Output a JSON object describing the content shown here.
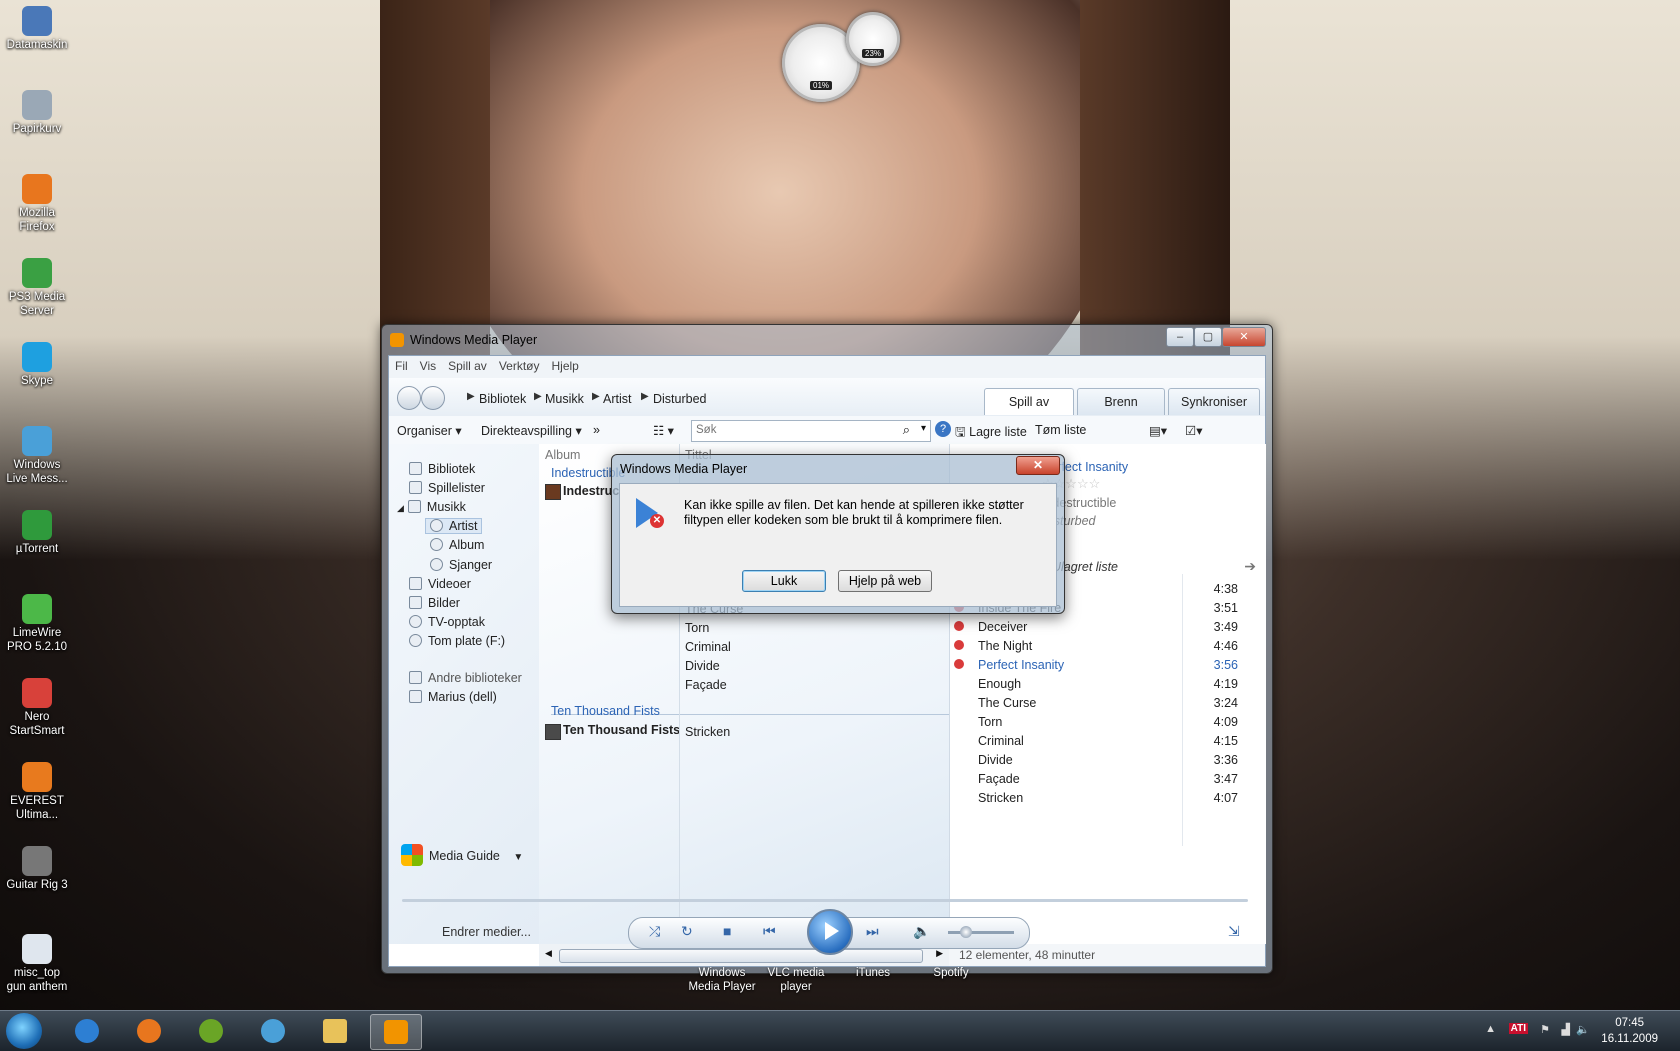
{
  "desktop_icons": [
    {
      "label": "Datamaskin",
      "icon": "computer-icon",
      "color": "#4a78b8"
    },
    {
      "label": "Papirkurv",
      "icon": "recycle-bin-icon",
      "color": "#9aa8b6"
    },
    {
      "label": "Mozilla Firefox",
      "icon": "firefox-icon",
      "color": "#e8761e"
    },
    {
      "label": "PS3 Media Server",
      "icon": "ps3-media-server-icon",
      "color": "#3aa043"
    },
    {
      "label": "Skype",
      "icon": "skype-icon",
      "color": "#1ea0e0"
    },
    {
      "label": "Windows Live Mess...",
      "icon": "messenger-icon",
      "color": "#4aa0d8"
    },
    {
      "label": "µTorrent",
      "icon": "utorrent-icon",
      "color": "#2f9a3c"
    },
    {
      "label": "LimeWire PRO 5.2.10",
      "icon": "limewire-icon",
      "color": "#4cb848"
    },
    {
      "label": "Nero StartSmart",
      "icon": "nero-icon",
      "color": "#d8413a"
    },
    {
      "label": "EVEREST Ultima...",
      "icon": "everest-icon",
      "color": "#e87a1e"
    },
    {
      "label": "Guitar Rig 3",
      "icon": "guitar-rig-icon",
      "color": "#777777"
    },
    {
      "label": "misc_top gun anthem",
      "icon": "mp3-file-icon",
      "color": "#dfe6ee"
    }
  ],
  "gadget": {
    "cpu_percent": "01%",
    "memory_percent": "23%"
  },
  "window": {
    "title": "Windows Media Player",
    "menu": [
      "Fil",
      "Vis",
      "Spill av",
      "Verktøy",
      "Hjelp"
    ],
    "breadcrumb": [
      "Bibliotek",
      "Musikk",
      "Artist",
      "Disturbed"
    ],
    "tabs": [
      "Spill av",
      "Brenn",
      "Synkroniser"
    ],
    "toolbar": {
      "organize": "Organiser",
      "stream": "Direkteavspilling",
      "more": "»",
      "search_placeholder": "Søk",
      "save_list": "Lagre liste",
      "clear_list": "Tøm liste"
    },
    "nav": {
      "library": "Bibliotek",
      "playlists": "Spillelister",
      "music": "Musikk",
      "artist": "Artist",
      "album": "Album",
      "genre": "Sjanger",
      "videos": "Videoer",
      "pictures": "Bilder",
      "tv": "TV-opptak",
      "blank_disc": "Tom plate (F:)",
      "other_libraries": "Andre biblioteker",
      "other_user": "Marius (dell)",
      "media_guide": "Media Guide"
    },
    "content": {
      "col_album": "Album",
      "col_title": "Tittel",
      "group1_link": "Indestructible",
      "group1_album": "Indestructible",
      "group1_tracks": [
        "The Curse",
        "Torn",
        "Criminal",
        "Divide",
        "Façade"
      ],
      "group2_link": "Ten Thousand Fists",
      "group2_album": "Ten Thousand Fists",
      "group2_tracks": [
        "Stricken"
      ]
    },
    "now_playing": {
      "title": "Perfect Insanity",
      "album": "Indestructible",
      "artist": "Disturbed",
      "list_name": "Ulagret liste"
    },
    "playlist": [
      {
        "name": "Inside The Fire",
        "duration": "3:51",
        "error": true,
        "playing": false
      },
      {
        "name": "Deceiver",
        "duration": "3:49",
        "error": true,
        "playing": false
      },
      {
        "name": "The Night",
        "duration": "4:46",
        "error": true,
        "playing": false
      },
      {
        "name": "Perfect Insanity",
        "duration": "3:56",
        "error": true,
        "playing": true
      },
      {
        "name": "Enough",
        "duration": "4:19",
        "error": false,
        "playing": false
      },
      {
        "name": "The Curse",
        "duration": "3:24",
        "error": false,
        "playing": false
      },
      {
        "name": "Torn",
        "duration": "4:09",
        "error": false,
        "playing": false
      },
      {
        "name": "Criminal",
        "duration": "4:15",
        "error": false,
        "playing": false
      },
      {
        "name": "Divide",
        "duration": "3:36",
        "error": false,
        "playing": false
      },
      {
        "name": "Façade",
        "duration": "3:47",
        "error": false,
        "playing": false
      },
      {
        "name": "Stricken",
        "duration": "4:07",
        "error": false,
        "playing": false
      }
    ],
    "first_row": {
      "name_fragment": "le",
      "duration": "4:38"
    },
    "status": "12 elementer, 48 minutter",
    "change_media": "Endrer medier..."
  },
  "dialog": {
    "title": "Windows Media Player",
    "message": "Kan ikke spille av filen. Det kan hende at spilleren ikke støtter filtypen eller kodeken som ble brukt til å komprimere filen.",
    "close_button": "Lukk",
    "help_button": "Hjelp på web"
  },
  "pinned_labels": [
    "Windows Media Player",
    "VLC media player",
    "iTunes",
    "Spotify"
  ],
  "taskbar": {
    "time": "07:45",
    "date": "16.11.2009",
    "tray_ati": "ATI"
  }
}
